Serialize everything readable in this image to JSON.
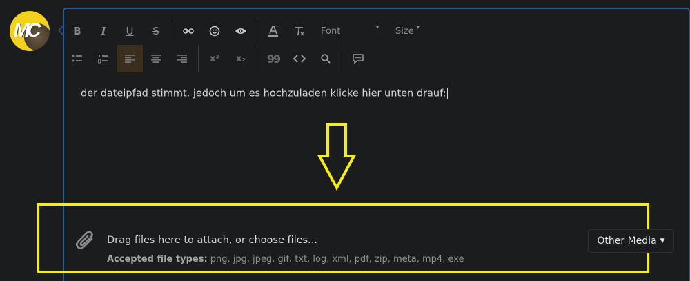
{
  "avatar": {
    "initials": "MC"
  },
  "toolbar": {
    "bold": "B",
    "italic": "I",
    "underline": "U",
    "strike": "S",
    "superscript": "x²",
    "subscript": "x₂",
    "quote": "99",
    "font_label": "Font",
    "size_label": "Size"
  },
  "editor": {
    "content": "der dateipfad stimmt, jedoch um es hochzuladen klicke hier unten drauf:"
  },
  "attachments": {
    "drag_text": "Drag files here to attach, or",
    "choose_link": "choose files...",
    "accepted_label": "Accepted file types:",
    "accepted_types": "png, jpg, jpeg, gif, txt, log, xml, pdf, zip, meta, mp4, exe",
    "other_media_label": "Other Media"
  },
  "colors": {
    "background": "#1b1c1e",
    "editor_border": "#2d5a9e",
    "annotation": "#f5ef16"
  }
}
